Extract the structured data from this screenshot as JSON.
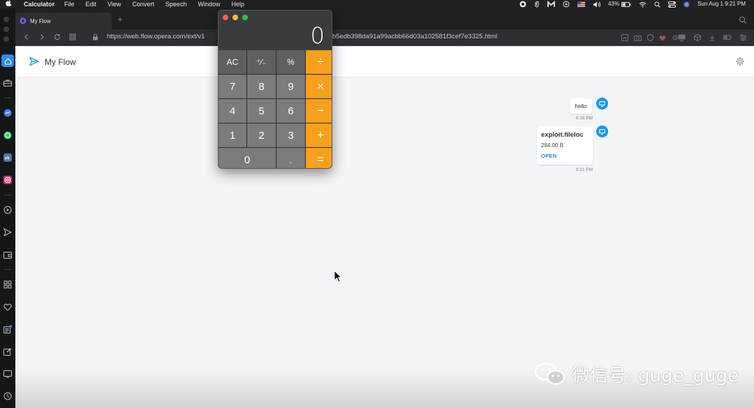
{
  "colors": {
    "accent": "#1596f5",
    "link": "#1d7fd6",
    "calc_operator": "#f9a01b",
    "calc_number": "#7b7c7e",
    "calc_function": "#5e5f61",
    "page_bg": "#f3f4f7"
  },
  "menubar": {
    "app_name": "Calculator",
    "menus": [
      "File",
      "Edit",
      "View",
      "Convert",
      "Speech",
      "Window",
      "Help"
    ],
    "battery": "43%",
    "clock": "Sun Aug 1  9:21 PM"
  },
  "browser": {
    "tab_title": "My Flow",
    "new_tab": "+",
    "url_start": "https://web.flow.opera.com/ext/v1",
    "url_end": "b5edb398da91a99acbb66d03a102581f3cef7e3325.html",
    "nav_icons": [
      "back-icon",
      "forward-icon",
      "reload-icon",
      "grid-icon",
      "lock-icon"
    ]
  },
  "flow": {
    "title": "My Flow",
    "messages": [
      {
        "text": "hello",
        "time": "8:39 PM"
      },
      {
        "file_name": "exploit.fileloc",
        "file_size": "284.00 B",
        "action": "OPEN",
        "time": "9:21 PM"
      }
    ]
  },
  "calculator": {
    "display": "0",
    "rows": [
      [
        "AC",
        "⁺∕₋",
        "%",
        "÷"
      ],
      [
        "7",
        "8",
        "9",
        "×"
      ],
      [
        "4",
        "5",
        "6",
        "−"
      ],
      [
        "1",
        "2",
        "3",
        "+"
      ],
      [
        "0",
        ".",
        "="
      ]
    ]
  },
  "watermark": {
    "text": "微信号: guge_guge"
  }
}
